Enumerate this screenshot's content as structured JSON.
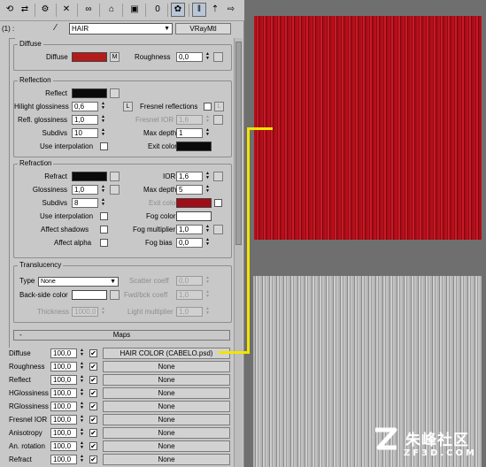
{
  "material": {
    "slot_number": "(1) :",
    "name": "HAIR",
    "type_button": "VRayMtl"
  },
  "diffuse_group": {
    "title": "Diffuse",
    "diffuse_label": "Diffuse",
    "diffuse_color": "#b41c1c",
    "m_button": "M",
    "roughness_label": "Roughness",
    "roughness_value": "0,0"
  },
  "reflection_group": {
    "title": "Reflection",
    "reflect_label": "Reflect",
    "reflect_color": "#0a0a0a",
    "hilight_label": "Hilight glossiness",
    "hilight_value": "0,6",
    "l_button": "L",
    "fresnel_label": "Fresnel reflections",
    "refl_gloss_label": "Refl. glossiness",
    "refl_gloss_value": "1,0",
    "fresnel_ior_label": "Fresnel IOR",
    "fresnel_ior_value": "1,6",
    "subdivs_label": "Subdivs",
    "subdivs_value": "10",
    "max_depth_label": "Max depth",
    "max_depth_value": "1",
    "use_interp_label": "Use interpolation",
    "exit_color_label": "Exit color",
    "exit_color": "#0a0a0a"
  },
  "refraction_group": {
    "title": "Refraction",
    "refract_label": "Refract",
    "refract_color": "#0a0a0a",
    "ior_label": "IOR",
    "ior_value": "1,6",
    "glossiness_label": "Glossiness",
    "glossiness_value": "1,0",
    "max_depth_label": "Max depth",
    "max_depth_value": "5",
    "subdivs_label": "Subdivs",
    "subdivs_value": "8",
    "exit_color_label": "Exit color",
    "exit_color": "#a00d18",
    "use_interp_label": "Use interpolation",
    "fog_color_label": "Fog color",
    "fog_color": "#ffffff",
    "affect_shadows_label": "Affect shadows",
    "fog_mult_label": "Fog multiplier",
    "fog_mult_value": "1,0",
    "affect_alpha_label": "Affect alpha",
    "fog_bias_label": "Fog bias",
    "fog_bias_value": "0,0"
  },
  "translucency_group": {
    "title": "Translucency",
    "type_label": "Type",
    "type_value": "None",
    "scatter_label": "Scatter coeff",
    "scatter_value": "0,0",
    "backside_label": "Back-side color",
    "backside_color": "#ffffff",
    "fwd_label": "Fwd/bck coeff",
    "fwd_value": "1,0",
    "thickness_label": "Thickness",
    "thickness_value": "1000,0",
    "light_mult_label": "Light multiplier",
    "light_mult_value": "1,0"
  },
  "maps": {
    "minus": "-",
    "title": "Maps",
    "rows": [
      {
        "label": "Diffuse",
        "amount": "100,0",
        "checked": "✔",
        "map": "HAIR COLOR (CABELO.psd)"
      },
      {
        "label": "Roughness",
        "amount": "100,0",
        "checked": "✔",
        "map": "None"
      },
      {
        "label": "Reflect",
        "amount": "100,0",
        "checked": "✔",
        "map": "None"
      },
      {
        "label": "HGlossiness",
        "amount": "100,0",
        "checked": "✔",
        "map": "None"
      },
      {
        "label": "RGlossiness",
        "amount": "100,0",
        "checked": "✔",
        "map": "None"
      },
      {
        "label": "Fresnel IOR",
        "amount": "100,0",
        "checked": "✔",
        "map": "None"
      },
      {
        "label": "Anisotropy",
        "amount": "100,0",
        "checked": "✔",
        "map": "None"
      },
      {
        "label": "An. rotation",
        "amount": "100,0",
        "checked": "✔",
        "map": "None"
      },
      {
        "label": "Refract",
        "amount": "100,0",
        "checked": "✔",
        "map": "None"
      }
    ]
  },
  "colors": {
    "connector": "#f2e400"
  },
  "watermark": {
    "text": "朱峰社区",
    "sub": "ZF3D.COM"
  }
}
